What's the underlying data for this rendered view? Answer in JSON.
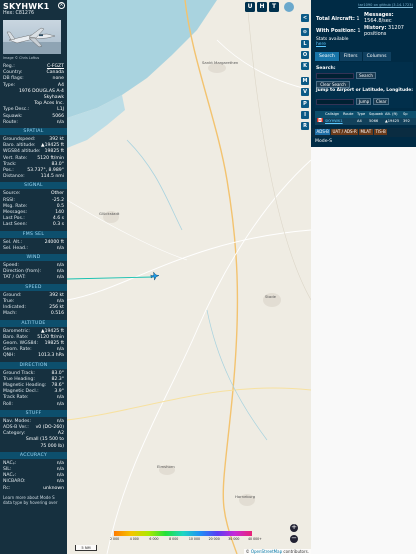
{
  "aircraft": {
    "callsign": "SKYHWK1",
    "hex_label": "Hex:",
    "hex": "C81276",
    "close": "×",
    "image_credit": "Image © Chris Loftus",
    "details": [
      {
        "k": "Reg.:",
        "v": "C-FGZT",
        "link": true
      },
      {
        "k": "Country:",
        "v": "Canada",
        "link": false
      },
      {
        "k": "DB flags:",
        "v": "none",
        "link": false
      },
      {
        "k": "Type:",
        "v": "A4",
        "link": false
      },
      {
        "k": "",
        "v": "1976 DOUGLAS A-4",
        "link": false
      },
      {
        "k": "",
        "v": "Skyhawk",
        "link": false
      },
      {
        "k": "",
        "v": "Top Aces Inc.",
        "link": false
      },
      {
        "k": "Type Desc.:",
        "v": "L1J",
        "link": false
      },
      {
        "k": "Squawk:",
        "v": "5066",
        "link": false
      },
      {
        "k": "Route:",
        "v": "n/a",
        "link": false
      }
    ],
    "sections": [
      {
        "title": "SPATIAL",
        "rows": [
          {
            "k": "Groundspeed:",
            "v": "392 kt"
          },
          {
            "k": "Baro. altitude:",
            "v": "▲19425 ft"
          },
          {
            "k": "WGS84 altitude:",
            "v": "19825 ft"
          },
          {
            "k": "Vert. Rate:",
            "v": "5120 ft/min"
          },
          {
            "k": "Track:",
            "v": "83.0°"
          },
          {
            "k": "Pos.:",
            "v": "53.737°, 8.989°"
          },
          {
            "k": "Distance:",
            "v": "114.5 nmi"
          }
        ]
      },
      {
        "title": "SIGNAL",
        "rows": [
          {
            "k": "Source:",
            "v": "Other"
          },
          {
            "k": "RSSI:",
            "v": "-25.2"
          },
          {
            "k": "Msg. Rate:",
            "v": "0.5"
          },
          {
            "k": "Messages:",
            "v": "140"
          },
          {
            "k": "Last Pos.:",
            "v": "4.6 s"
          },
          {
            "k": "Last Seen:",
            "v": "0.3 s"
          }
        ]
      },
      {
        "title": "FMS SEL",
        "rows": [
          {
            "k": "Sel. Alt.:",
            "v": "24000 ft"
          },
          {
            "k": "Sel. Head.:",
            "v": "n/a"
          }
        ]
      },
      {
        "title": "WIND",
        "rows": [
          {
            "k": "Speed:",
            "v": "n/a"
          },
          {
            "k": "Direction (from):",
            "v": "n/a"
          },
          {
            "k": "TAT / OAT:",
            "v": "n/a"
          }
        ]
      },
      {
        "title": "SPEED",
        "rows": [
          {
            "k": "Ground:",
            "v": "392 kt"
          },
          {
            "k": "True:",
            "v": "n/a"
          },
          {
            "k": "Indicated:",
            "v": "256 kt"
          },
          {
            "k": "Mach:",
            "v": "0.516"
          }
        ]
      },
      {
        "title": "ALTITUDE",
        "rows": [
          {
            "k": "Barometric:",
            "v": "▲19425 ft"
          },
          {
            "k": "Baro. Rate:",
            "v": "5120 ft/min"
          },
          {
            "k": "Geom. WGS84:",
            "v": "19825 ft"
          },
          {
            "k": "Geom. Rate:",
            "v": "n/a"
          },
          {
            "k": "QNH:",
            "v": "1013.3 hPa"
          }
        ]
      },
      {
        "title": "DIRECTION",
        "rows": [
          {
            "k": "Ground Track:",
            "v": "83.0°"
          },
          {
            "k": "True Heading:",
            "v": "82.3°"
          },
          {
            "k": "Magnetic Heading:",
            "v": "78.6°"
          },
          {
            "k": "Magnetic Decl.:",
            "v": "3.9°"
          },
          {
            "k": "Track Rate:",
            "v": "n/a"
          },
          {
            "k": "Roll:",
            "v": "n/a"
          }
        ]
      },
      {
        "title": "STUFF",
        "rows": [
          {
            "k": "Nav. Modes:",
            "v": "n/a"
          },
          {
            "k": "ADS-B Ver.:",
            "v": "v0 (DO-260)"
          },
          {
            "k": "Category:",
            "v": "A2"
          },
          {
            "k": "",
            "v": "Small (15 500 to"
          },
          {
            "k": "",
            "v": "75 000 lb)"
          }
        ]
      },
      {
        "title": "ACCURACY",
        "rows": [
          {
            "k": "NACₚ:",
            "v": "n/a"
          },
          {
            "k": "SIL:",
            "v": "n/a"
          },
          {
            "k": "NACᵥ:",
            "v": "n/a"
          },
          {
            "k": "NICBARO:",
            "v": "n/a"
          },
          {
            "k": "Rc:",
            "v": "unknown"
          }
        ]
      }
    ],
    "footer": "Learn more about Mode S data type by hovering over"
  },
  "map": {
    "buttons_top": [
      {
        "label": "U",
        "name": "map-u-button"
      },
      {
        "label": "H",
        "name": "map-h-button"
      },
      {
        "label": "T",
        "name": "map-t-button"
      }
    ],
    "zoom_in": "+",
    "zoom_out": "−",
    "scale_label": "5 NM",
    "attribution_prefix": "© ",
    "attribution_link": "OpenStreetMap",
    "attribution_suffix": " contributors.",
    "altitude_ticks": [
      "2 000",
      "4 000",
      "6 000",
      "8 000",
      "10 000",
      "20 000",
      "30 000",
      "40 000+"
    ],
    "place_labels": [
      "Sankt Margarethen",
      "Glückstadt",
      "Stade",
      "Elmshorn",
      "Horneburg"
    ],
    "colors": {
      "track": "#15c0b0",
      "aircraft": "#1e9be8",
      "water": "#a9d3df",
      "land": "#efece3"
    }
  },
  "panel": {
    "version": "tar1090 on github (3.14.1723)",
    "stats": [
      {
        "label": "Total Aircraft:",
        "value": "1"
      },
      {
        "label": "With Position:",
        "value": "1"
      },
      {
        "label": "Messages:",
        "value": "1564.8/sec"
      },
      {
        "label": "History:",
        "value": "31207 positions"
      }
    ],
    "stats_available": "Stats available",
    "stats_link": "here",
    "strip_buttons": [
      "<",
      "⊙",
      "L",
      "O",
      "K",
      "M",
      "V",
      "P",
      "I",
      "R"
    ],
    "tabs": [
      "Search",
      "Filters",
      "Columns"
    ],
    "search_label": "Search:",
    "search_button": "Search",
    "clear_search": "Clear Search",
    "jump_label": "Jump to Airport or Latitude, Longitude:",
    "jump_button": "Jump",
    "clear_button": "Clear",
    "table_headers": [
      "",
      "Callsign",
      "Route",
      "Type",
      "Squawk",
      "Alt. (ft)",
      "Sp"
    ],
    "table_row": {
      "flag": "Canada",
      "callsign": "SKYHWK1",
      "route": "",
      "type": "A4",
      "squawk": "5066",
      "alt": "▲19425",
      "speed": "392"
    },
    "sources": [
      {
        "label": "ADS-B",
        "color": "#1e6fa8"
      },
      {
        "label": "UAT / ADS-R",
        "color": "#6a3a1a"
      },
      {
        "label": "MLAT",
        "color": "#6a3a1a"
      },
      {
        "label": "TIS-B",
        "color": "#6a3a1a"
      }
    ],
    "modes_label": "Mode-S"
  }
}
